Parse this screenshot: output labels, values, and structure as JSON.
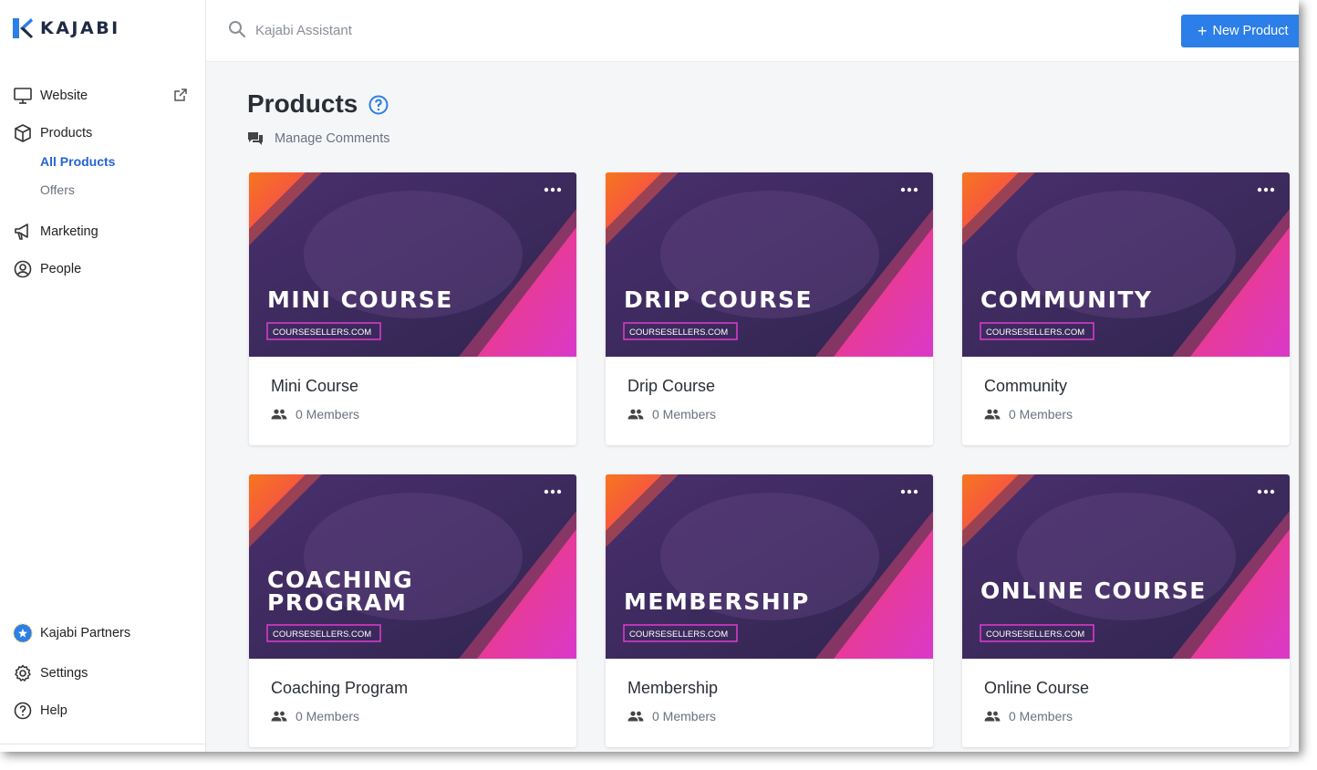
{
  "brand": {
    "name": "KAJABI",
    "accent": "#2c7ee8"
  },
  "sidebar": {
    "items": [
      {
        "label": "Website",
        "icon": "monitor-icon"
      },
      {
        "label": "Products",
        "icon": "box-icon",
        "subitems": [
          "All Products",
          "Offers"
        ]
      },
      {
        "label": "Marketing",
        "icon": "megaphone-icon"
      },
      {
        "label": "People",
        "icon": "user-circle-icon"
      }
    ],
    "bottom": [
      {
        "label": "Kajabi Partners",
        "icon": "partners-star-icon"
      },
      {
        "label": "Settings",
        "icon": "gear-icon"
      },
      {
        "label": "Help",
        "icon": "help-circle-icon"
      }
    ]
  },
  "topbar": {
    "search_placeholder": "Kajabi Assistant",
    "new_product_label": "New Product"
  },
  "page": {
    "title": "Products",
    "manage_comments": "Manage Comments"
  },
  "products": [
    {
      "banner": [
        "MINI COURSE"
      ],
      "watermark": "COURSESELLERS.COM",
      "title": "Mini Course",
      "members": "0 Members"
    },
    {
      "banner": [
        "DRIP COURSE"
      ],
      "watermark": "COURSESELLERS.COM",
      "title": "Drip Course",
      "members": "0 Members"
    },
    {
      "banner": [
        "COMMUNITY"
      ],
      "watermark": "COURSESELLERS.COM",
      "title": "Community",
      "members": "0 Members"
    },
    {
      "banner": [
        "COACHING",
        "PROGRAM"
      ],
      "watermark": "COURSESELLERS.COM",
      "title": "Coaching Program",
      "members": "0 Members"
    },
    {
      "banner": [
        "MEMBERSHIP"
      ],
      "watermark": "COURSESELLERS.COM",
      "title": "Membership",
      "members": "0 Members"
    },
    {
      "banner": [
        "ONLINE COURSE"
      ],
      "watermark": "COURSESELLERS.COM",
      "title": "Online Course",
      "members": "0 Members"
    }
  ]
}
